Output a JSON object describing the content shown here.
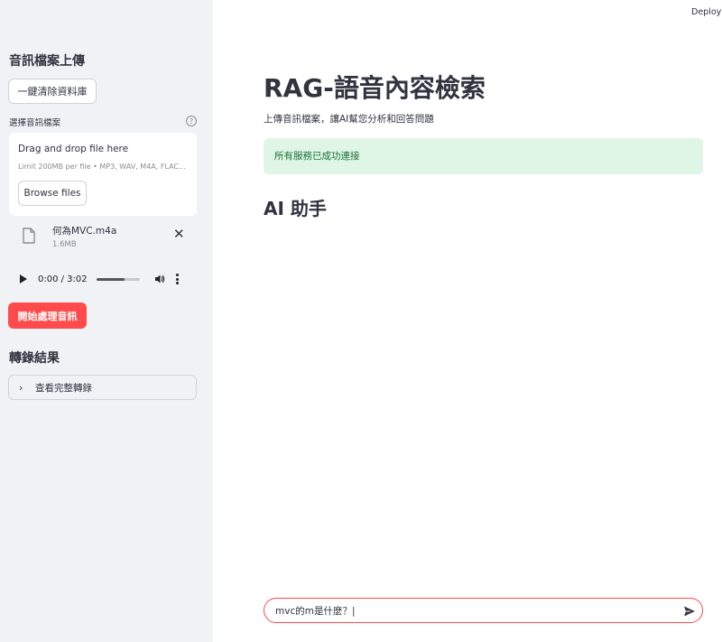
{
  "sidebar": {
    "title": "音訊檔案上傳",
    "clear_button": "一鍵清除資料庫",
    "select_label": "選擇音訊檔案",
    "help_icon": "?",
    "dropzone": {
      "title": "Drag and drop file here",
      "limit": "Limit 200MB per file • MP3, WAV, M4A, FLAC...",
      "browse_button": "Browse files"
    },
    "file": {
      "name": "何為MVC.m4a",
      "size": "1.6MB",
      "icon": "file-icon",
      "close": "✕"
    },
    "audio": {
      "time": "0:00 / 3:02",
      "progress": 0.65
    },
    "process_button": "開始處理音訊",
    "results_title": "轉錄結果",
    "expander_chevron": "›",
    "expander_label": "查看完整轉錄"
  },
  "header": {
    "deploy": "Deploy"
  },
  "main": {
    "title": "RAG-語音內容檢索",
    "subtitle": "上傳音訊檔案，讓AI幫您分析和回答問題",
    "alert": "所有服務已成功連接",
    "section_title": "AI 助手"
  },
  "chat": {
    "input_value": "mvc的m是什麼？|"
  },
  "colors": {
    "accent": "#ff4b4b",
    "sidebar_bg": "#f0f2f6",
    "success_bg": "#dff5e6",
    "success_text": "#177233"
  }
}
